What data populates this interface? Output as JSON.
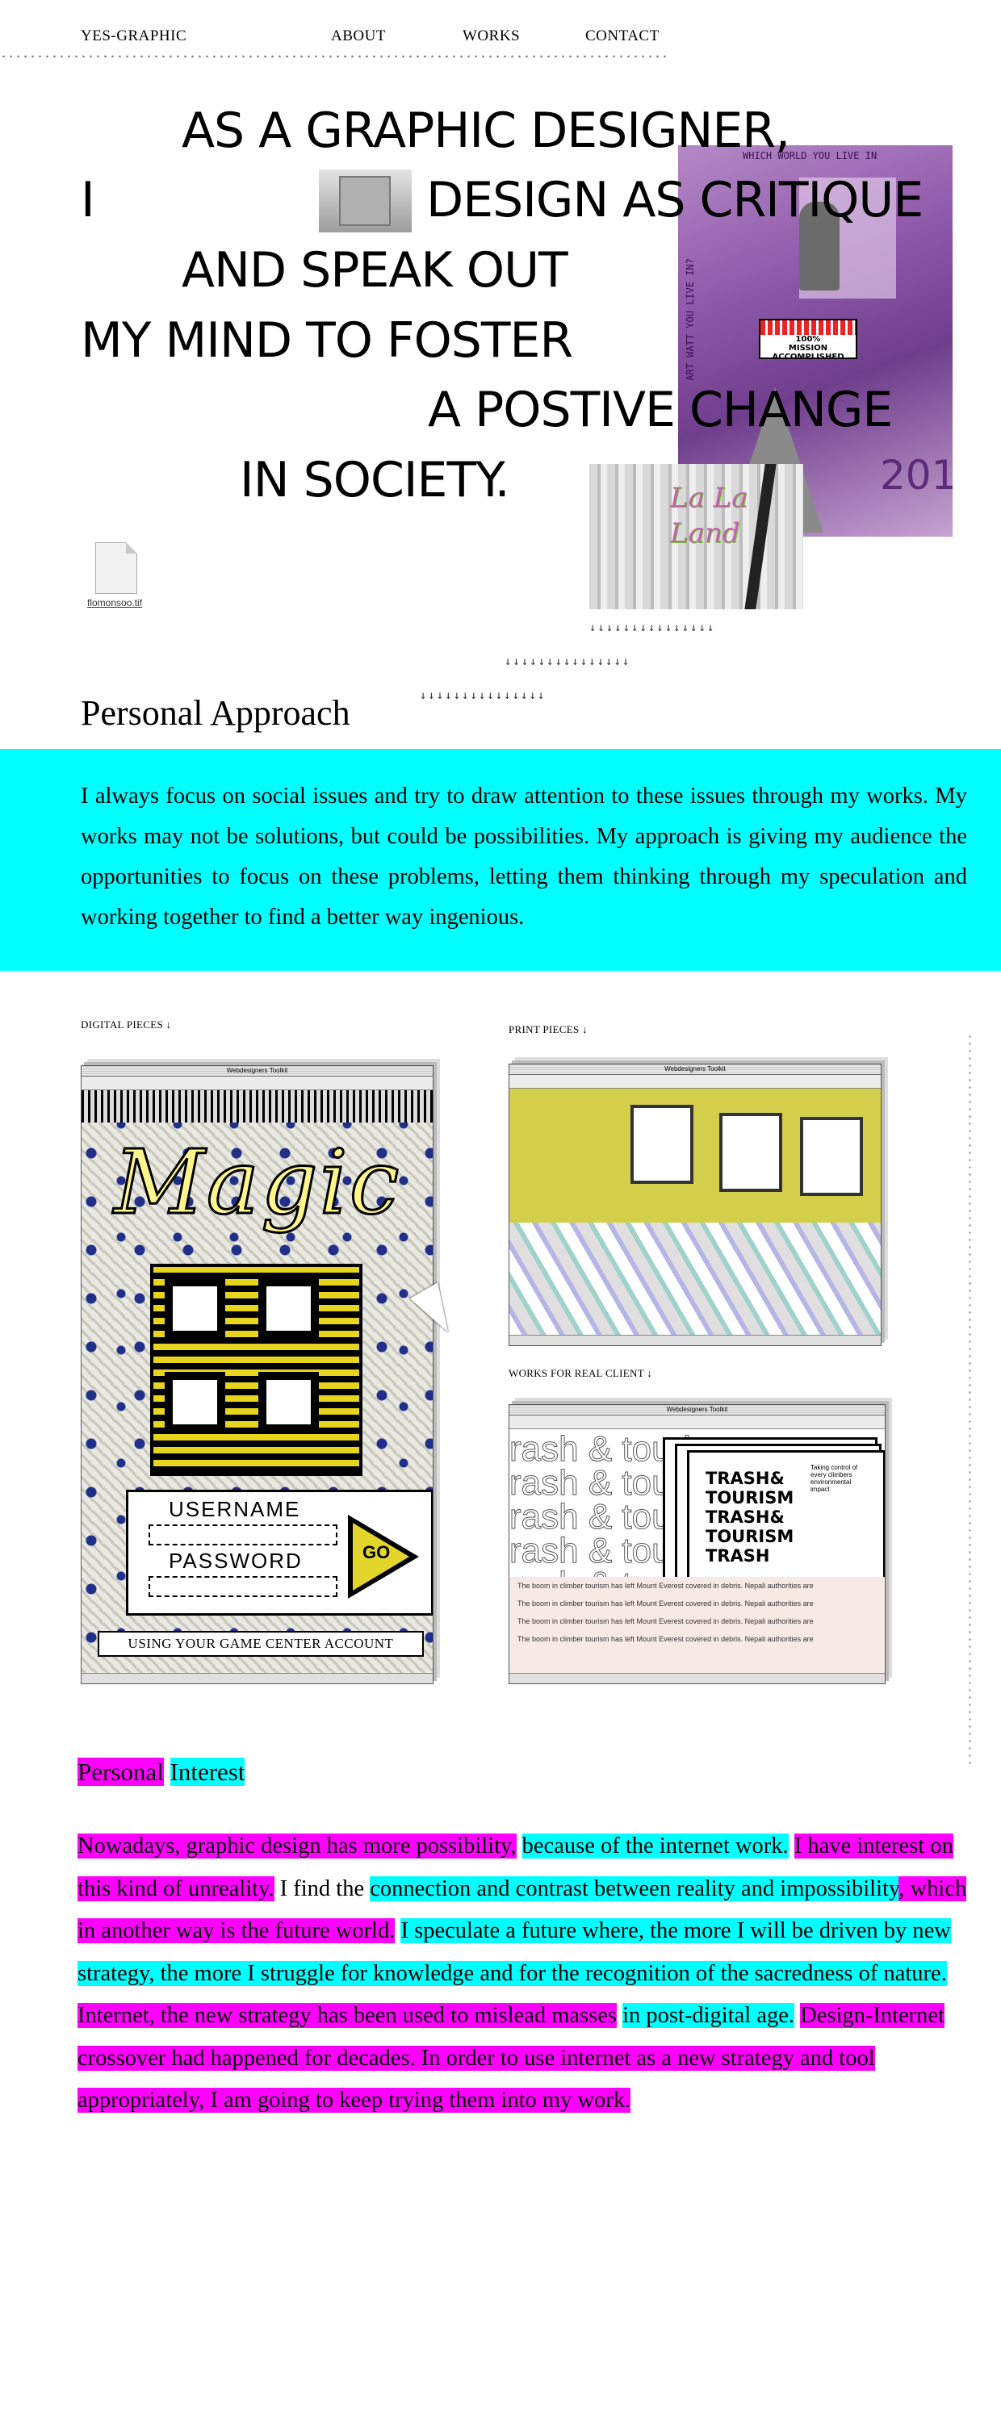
{
  "nav": {
    "brand": "YES-GRAPHIC",
    "about": "ABOUT",
    "works": "WORKS",
    "contact": "CONTACT"
  },
  "hero": {
    "line1": "AS A GRAPHIC DESIGNER,",
    "line2a": "I",
    "line2b": "DESIGN AS CRITIQUE",
    "line3": "AND SPEAK OUT",
    "line4": "MY MIND TO FOSTER",
    "line5": "A POSTIVE CHANGE",
    "line6": "IN SOCIETY.",
    "file_label": "flomonsoo.tif",
    "poster_top_text": "WHICH WORLD YOU LIVE IN",
    "poster_side_text": "ART WATT YOU LIVE IN?",
    "mission_line1": "100%",
    "mission_line2": "MISSION ACCOMPLISHED",
    "traffic_text": "La La Land",
    "arrows": "↓↓↓↓↓↓↓↓↓↓↓↓↓↓↓"
  },
  "approach": {
    "title": "Personal Approach",
    "body": "I always focus on social issues and try to draw attention to these issues through my works. My works may not be solutions, but could be possibilities. My approach is giving my audience the opportunities to focus on these problems, letting them thinking through my speculation and working together to find a better way ingenious."
  },
  "works": {
    "digital_label": "DIGITAL PIECES ↓",
    "print_label": "PRINT PIECES ↓",
    "client_label": "WORKS FOR REAL CLIENT ↓",
    "window_title": "Webdesigners Toolkit",
    "magic": {
      "word": "Magic",
      "username": "USERNAME",
      "password": "PASSWORD",
      "go": "GO",
      "game_center": "USING YOUR GAME CENTER  ACCOUNT"
    },
    "trash": {
      "bg_word": "rash & touris",
      "card_title_1": "TRASH&",
      "card_title_2": "TOURISM",
      "card_title_3": "TRASH&",
      "card_title_4": "TOURISM",
      "card_title_5": "TRASH",
      "side_note": "Taking control of every climbers environmental impact",
      "strip_line": "The boom in climber tourism has left Mount Everest covered in debris. Nepali authorities are"
    }
  },
  "interest": {
    "title_1": "Personal",
    "title_2": "Interest",
    "s1": "Nowadays, graphic design has more possibility,",
    "s2": "because of the internet work.",
    "s3": "I have interest on this kind of unreality.",
    "s4": "I find the",
    "s5": "connection and contrast between reality and impossibility",
    "s6": ", which in another way is the future world.",
    "s7": "I speculate a future where, the more I will be driven by new strategy, the more I struggle for knowledge and for the recognition of the sacredness of nature.",
    "s8": "Internet, the new strategy has been used to mislead masses",
    "s9": "in post-digital age.",
    "s10": "Design-Internet crossover had happened for decades. In order to use internet as a new strategy and tool appropriately, I am going to keep trying them into my work."
  },
  "colors": {
    "cyan": "#00ffff",
    "magenta": "#ff00ff"
  }
}
